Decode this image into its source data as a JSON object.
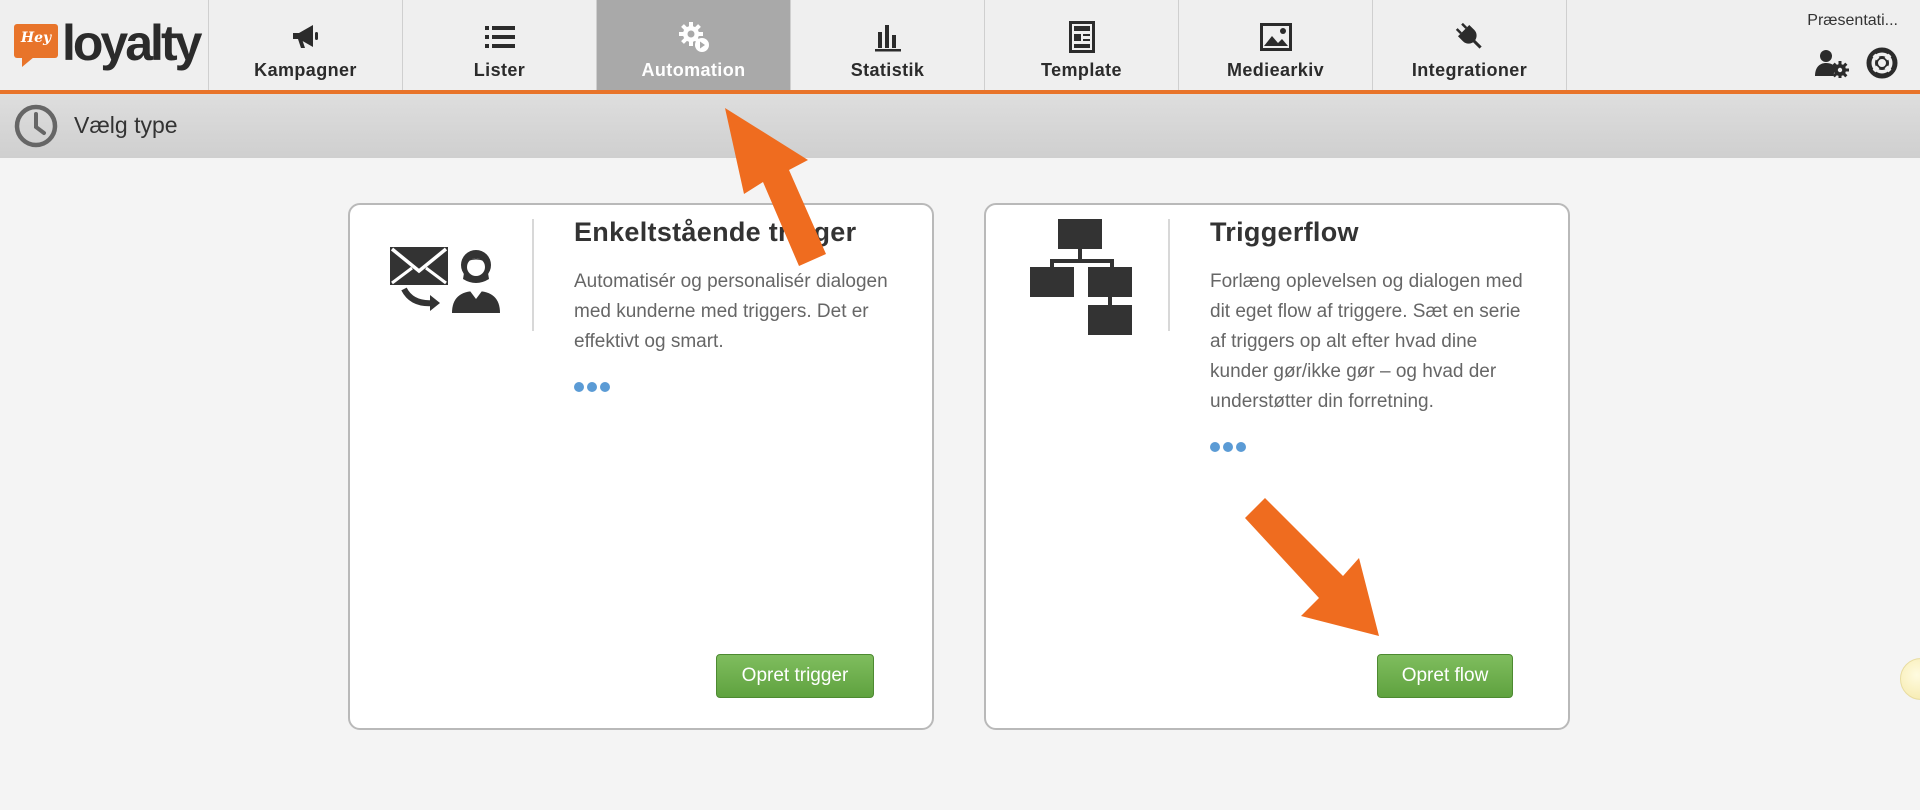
{
  "app": {
    "logo_badge": "Hey",
    "logo_word": "loyalty"
  },
  "nav": {
    "items": [
      {
        "label": "Kampagner",
        "icon": "megaphone-icon"
      },
      {
        "label": "Lister",
        "icon": "list-icon"
      },
      {
        "label": "Automation",
        "icon": "gears-icon",
        "active": true
      },
      {
        "label": "Statistik",
        "icon": "bar-chart-icon"
      },
      {
        "label": "Template",
        "icon": "template-icon"
      },
      {
        "label": "Mediearkiv",
        "icon": "image-icon"
      },
      {
        "label": "Integrationer",
        "icon": "plug-icon"
      }
    ],
    "user_name": "Præsentati...",
    "user_settings_icon": "user-settings-icon",
    "help_icon": "lifebuoy-icon"
  },
  "subheader": {
    "title": "Vælg type",
    "icon": "clock-icon"
  },
  "cards": [
    {
      "title": "Enkeltstående trigger",
      "description": "Automatisér og personalisér dialogen med kunderne med triggers. Det er effektivt og smart.",
      "icon": "mail-person-icon",
      "button": "Opret trigger"
    },
    {
      "title": "Triggerflow",
      "description": "Forlæng oplevelsen og dialogen med dit eget flow af triggere. Sæt en serie af triggers op alt efter hvad dine kunder gør/ikke gør – og hvad der understøtter din forretning.",
      "icon": "flowchart-icon",
      "button": "Opret flow"
    }
  ],
  "colors": {
    "accent": "#e8742a",
    "active_tab": "#a9a9a9",
    "button_green": "#6aab48",
    "dots": "#5b9bd5"
  }
}
